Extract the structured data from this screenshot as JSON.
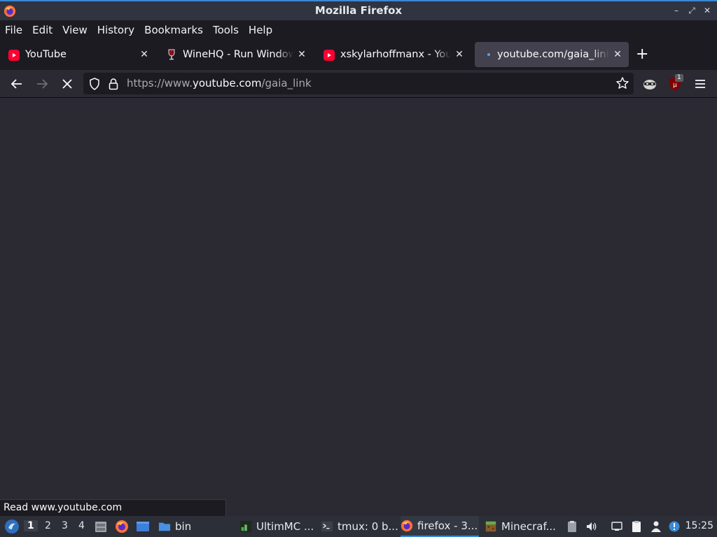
{
  "window": {
    "title": "Mozilla Firefox",
    "controls": [
      "–",
      "⤢",
      "✕"
    ]
  },
  "menubar": {
    "items": [
      "File",
      "Edit",
      "View",
      "History",
      "Bookmarks",
      "Tools",
      "Help"
    ]
  },
  "tabs": [
    {
      "label": "YouTube",
      "favicon": "youtube-icon",
      "active": false
    },
    {
      "label": "WineHQ - Run Windows applications on Linux",
      "favicon": "wine-icon",
      "active": false
    },
    {
      "label": "xskylarhoffmanx - YouTube",
      "favicon": "youtube-icon",
      "active": false
    },
    {
      "label": "youtube.com/gaia_link",
      "favicon": "loading-icon",
      "active": true
    }
  ],
  "tab_close_glyph": "✕",
  "new_tab_glyph": "+",
  "navbar": {
    "url_prefix": "https://www.",
    "url_host": "youtube.com",
    "url_path": "/gaia_link",
    "extension_badge": "1"
  },
  "status": {
    "text": "Read www.youtube.com"
  },
  "taskbar": {
    "workspaces": [
      "1",
      "2",
      "3",
      "4"
    ],
    "active_workspace": "1",
    "folder_label": "bin",
    "tasks": [
      {
        "label": "UltimMC ...",
        "icon": "ultimmc-icon"
      },
      {
        "label": "tmux: 0 b...",
        "icon": "terminal-icon"
      },
      {
        "label": "firefox - 3...",
        "icon": "firefox-icon",
        "active": true
      },
      {
        "label": "Minecraf...",
        "icon": "minecraft-icon"
      }
    ],
    "clock": "15:25"
  },
  "colors": {
    "accent": "#3a88d6",
    "youtube_red": "#ff0033",
    "tab_active": "#42414d",
    "toolbar_bg": "#1c1b22",
    "content_bg": "#2b2a33"
  }
}
